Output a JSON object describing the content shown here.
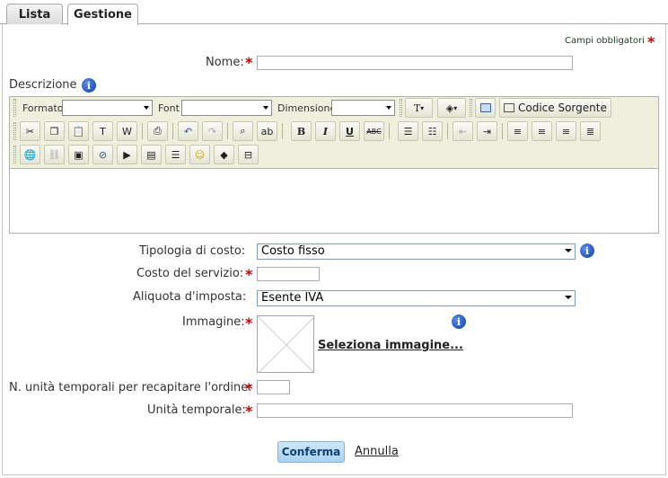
{
  "tabs": [
    {
      "label": "Lista",
      "active": false
    },
    {
      "label": "Gestione",
      "active": true
    }
  ],
  "required_note": "Campi obbligatori",
  "form": {
    "name_label": "Nome:",
    "name_value": "",
    "description_label": "Descrizione",
    "cost_type_label": "Tipologia di costo:",
    "cost_type_value": "Costo fisso",
    "service_cost_label": "Costo del servizio:",
    "service_cost_value": "",
    "tax_rate_label": "Aliquota d'imposta:",
    "tax_rate_value": "Esente IVA",
    "image_label": "Immagine:",
    "select_image_link": "Seleziona immagine...",
    "time_units_label": "N. unità temporali per recapitare l'ordine:",
    "time_units_value": "",
    "time_unit_label": "Unità temporale:",
    "time_unit_value": ""
  },
  "editor": {
    "format_label": "Formato",
    "font_label": "Font",
    "size_label": "Dimensione",
    "source_label": "Codice Sorgente"
  },
  "actions": {
    "confirm": "Conferma",
    "cancel": "Annulla"
  },
  "colors": {
    "required": "#cc0000",
    "toolbar_bg": "#efefde",
    "confirm_bg": "#a9d2f2"
  }
}
